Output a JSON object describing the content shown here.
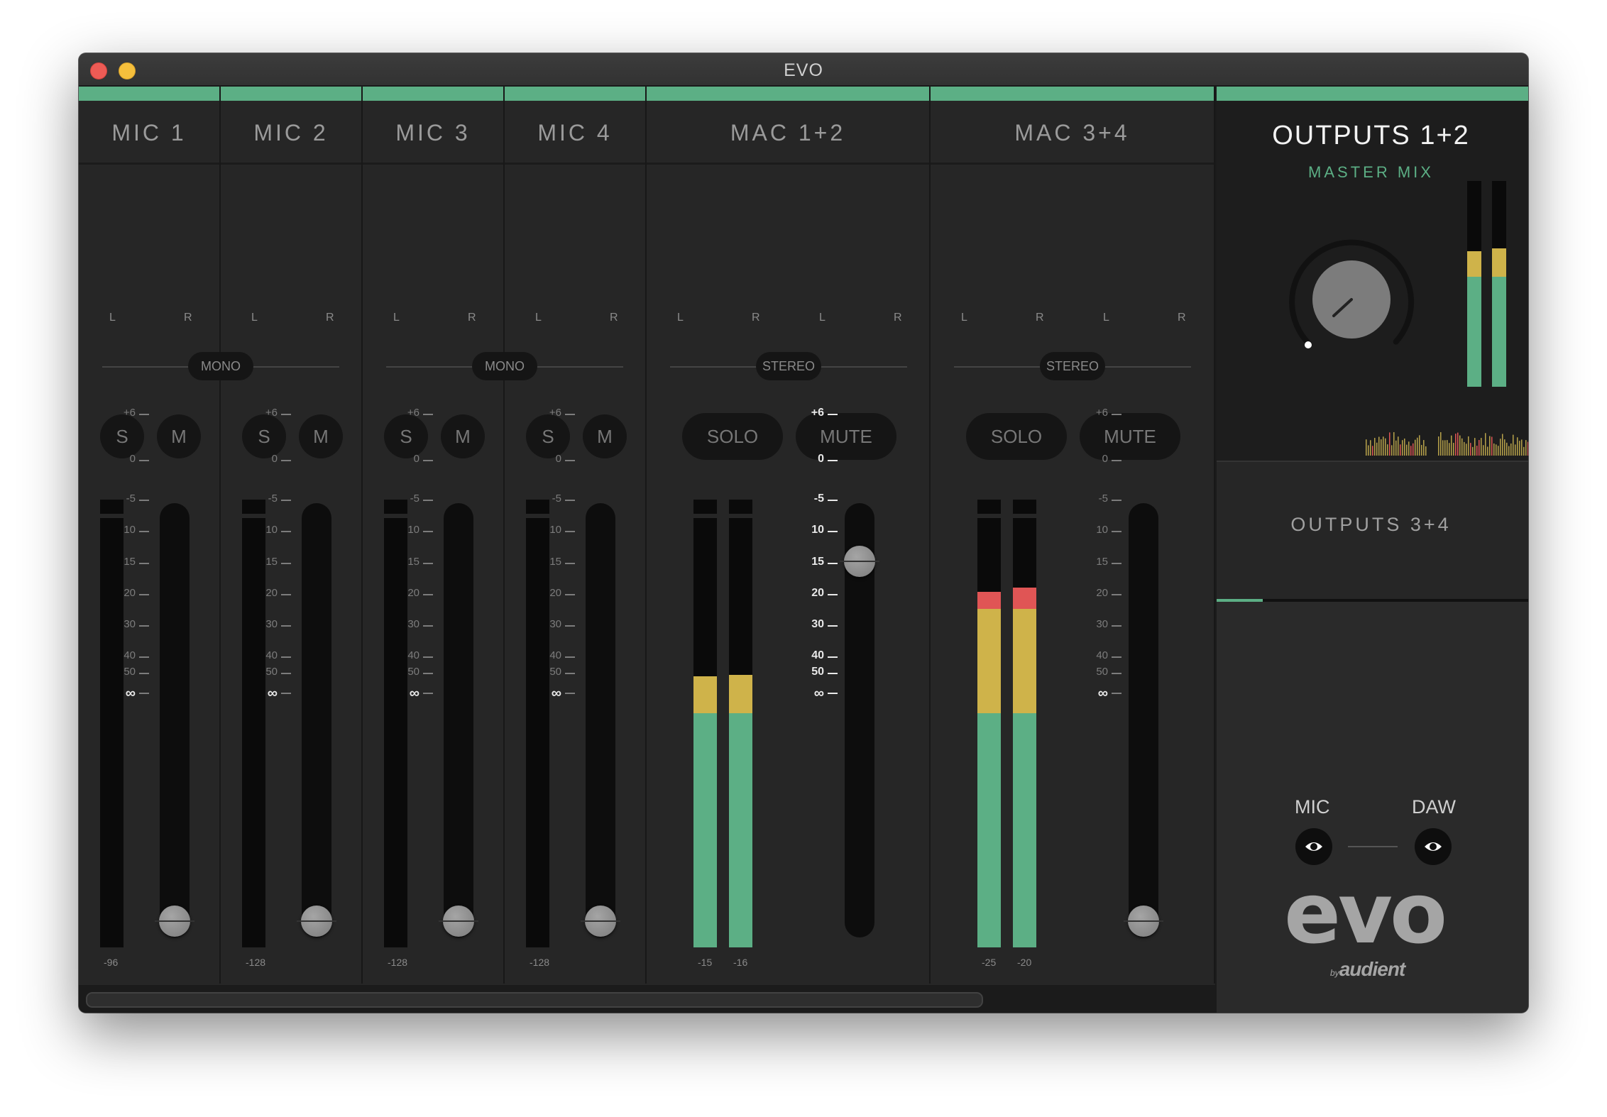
{
  "window": {
    "title": "EVO"
  },
  "channels": [
    {
      "name": "MIC 1",
      "mode": "MONO",
      "solo": "S",
      "mute": "M",
      "peak": "-96",
      "pan_left": "L",
      "pan_right": "R"
    },
    {
      "name": "MIC 2",
      "mode": "MONO",
      "solo": "S",
      "mute": "M",
      "peak": "-128",
      "pan_left": "L",
      "pan_right": "R"
    },
    {
      "name": "MIC 3",
      "mode": "MONO",
      "solo": "S",
      "mute": "M",
      "peak": "-128",
      "pan_left": "L",
      "pan_right": "R"
    },
    {
      "name": "MIC 4",
      "mode": "MONO",
      "solo": "S",
      "mute": "M",
      "peak": "-128",
      "pan_left": "L",
      "pan_right": "R"
    },
    {
      "name": "MAC 1+2",
      "mode": "STEREO",
      "solo": "SOLO",
      "mute": "MUTE",
      "peak_l": "-15",
      "peak_r": "-16",
      "pan_left": "L",
      "pan_right": "R"
    },
    {
      "name": "MAC 3+4",
      "mode": "STEREO",
      "solo": "SOLO",
      "mute": "MUTE",
      "peak_l": "-25",
      "peak_r": "-20",
      "pan_left": "L",
      "pan_right": "R"
    }
  ],
  "fader_scale": [
    "+6",
    "0",
    "-5",
    "10",
    "15",
    "20",
    "30",
    "40",
    "50",
    "∞"
  ],
  "outputs_12": {
    "title": "OUTPUTS 1+2",
    "subtitle": "MASTER MIX"
  },
  "outputs_34": {
    "title": "OUTPUTS 3+4"
  },
  "monitor": {
    "mic_label": "MIC",
    "daw_label": "DAW"
  },
  "brand": {
    "logo": "evo",
    "byline_small": "by",
    "byline": "audient"
  },
  "icons": [
    "eye-icon",
    "eye-icon"
  ],
  "colors": {
    "accent": "#5caf85",
    "meter_green": "#5caf85",
    "meter_yellow": "#cfb34a",
    "meter_red": "#e05555"
  }
}
